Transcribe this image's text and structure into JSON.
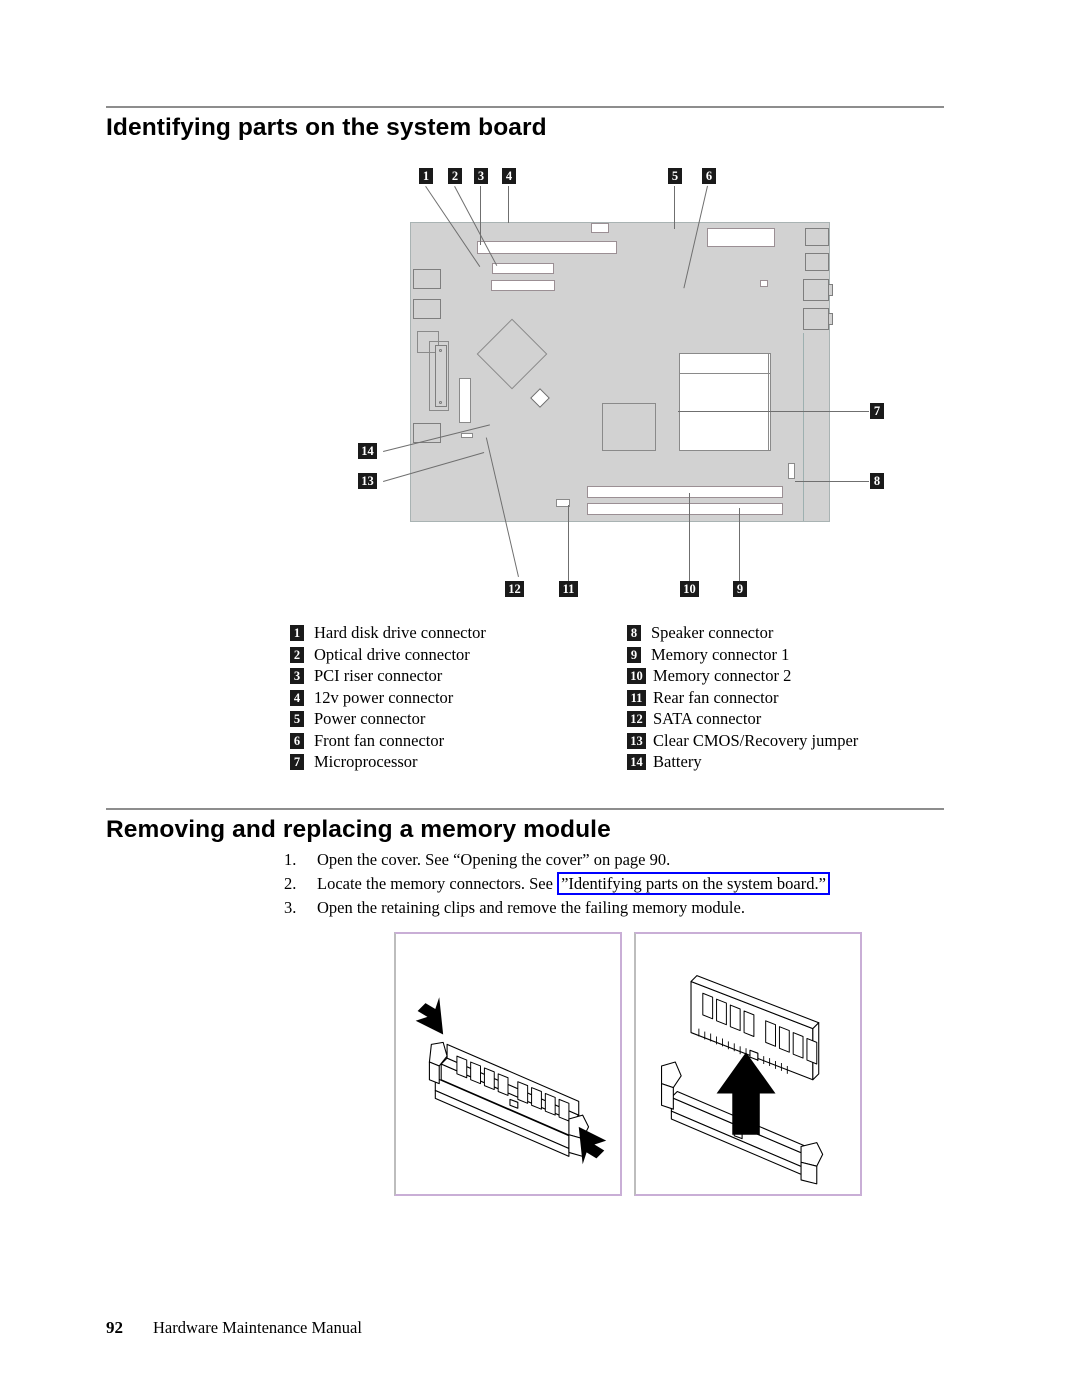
{
  "sections": {
    "board_heading": "Identifying parts on the system board",
    "memory_heading": "Removing and replacing a memory module"
  },
  "board_diagram": {
    "callouts": [
      {
        "id": "1",
        "number": "1"
      },
      {
        "id": "2",
        "number": "2"
      },
      {
        "id": "3",
        "number": "3"
      },
      {
        "id": "4",
        "number": "4"
      },
      {
        "id": "5",
        "number": "5"
      },
      {
        "id": "6",
        "number": "6"
      },
      {
        "id": "7",
        "number": "7"
      },
      {
        "id": "8",
        "number": "8"
      },
      {
        "id": "9",
        "number": "9"
      },
      {
        "id": "10",
        "number": "10"
      },
      {
        "id": "11",
        "number": "11"
      },
      {
        "id": "12",
        "number": "12"
      },
      {
        "id": "13",
        "number": "13"
      },
      {
        "id": "14",
        "number": "14"
      }
    ]
  },
  "legend": {
    "left": [
      {
        "number": "1",
        "label": "Hard disk drive connector"
      },
      {
        "number": "2",
        "label": "Optical drive connector"
      },
      {
        "number": "3",
        "label": "PCI riser connector"
      },
      {
        "number": "4",
        "label": "12v power connector"
      },
      {
        "number": "5",
        "label": "Power connector"
      },
      {
        "number": "6",
        "label": "Front fan connector"
      },
      {
        "number": "7",
        "label": "Microprocessor"
      }
    ],
    "right": [
      {
        "number": "8",
        "label": "Speaker connector"
      },
      {
        "number": "9",
        "label": "Memory connector 1"
      },
      {
        "number": "10",
        "label": "Memory connector 2"
      },
      {
        "number": "11",
        "label": "Rear fan connector"
      },
      {
        "number": "12",
        "label": "SATA connector"
      },
      {
        "number": "13",
        "label": "Clear CMOS/Recovery jumper"
      },
      {
        "number": "14",
        "label": "Battery"
      }
    ]
  },
  "steps": [
    {
      "number": "1.",
      "before": "Open the cover. See “Opening the cover” on page 90.",
      "link": "",
      "after": ""
    },
    {
      "number": "2.",
      "before": "Locate the memory connectors. See ",
      "link": "”Identifying parts on the system board.”",
      "after": ""
    },
    {
      "number": "3.",
      "before": "Open the retaining clips and remove the failing memory module.",
      "link": "",
      "after": ""
    }
  ],
  "figures": {
    "remove_caption": "memory module with retaining clips opening outward",
    "lift_caption": "memory module lifted out of the socket"
  },
  "footer": {
    "page_number": "92",
    "manual_title": "Hardware Maintenance Manual"
  },
  "colors": {
    "link_border": "#0000ff",
    "badge_bg": "#1a1a1a",
    "board_fill": "#d2d2d2",
    "rule": "#8d8d8d",
    "figure_border": "#c9aed6"
  }
}
